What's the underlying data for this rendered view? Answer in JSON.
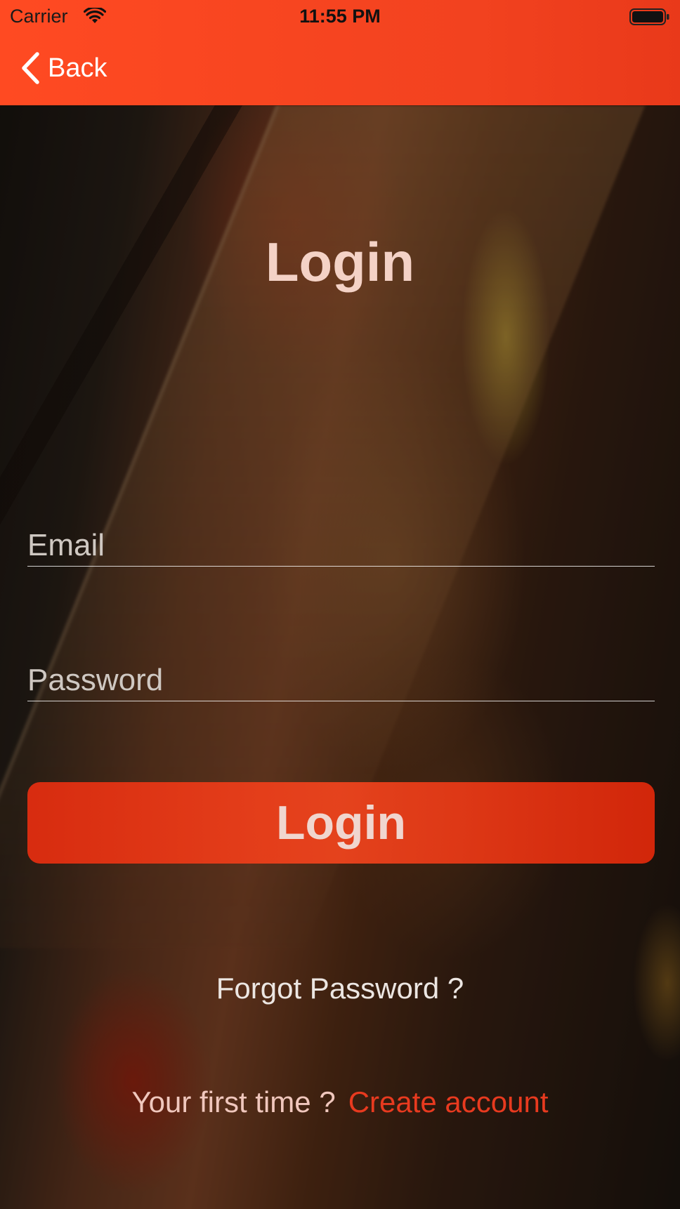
{
  "status_bar": {
    "carrier": "Carrier",
    "time": "11:55 PM",
    "wifi_icon": "wifi-icon",
    "battery_icon": "battery-icon"
  },
  "nav": {
    "back_label": "Back",
    "back_icon": "chevron-left-icon",
    "background_color": "#f2421f"
  },
  "login": {
    "title": "Login",
    "email": {
      "value": "",
      "placeholder": "Email"
    },
    "password": {
      "value": "",
      "placeholder": "Password"
    },
    "submit_label": "Login",
    "forgot_label": "Forgot Password ?",
    "first_time_label": "Your first time ?",
    "create_account_label": "Create account",
    "accent_color": "#e83a1f"
  }
}
